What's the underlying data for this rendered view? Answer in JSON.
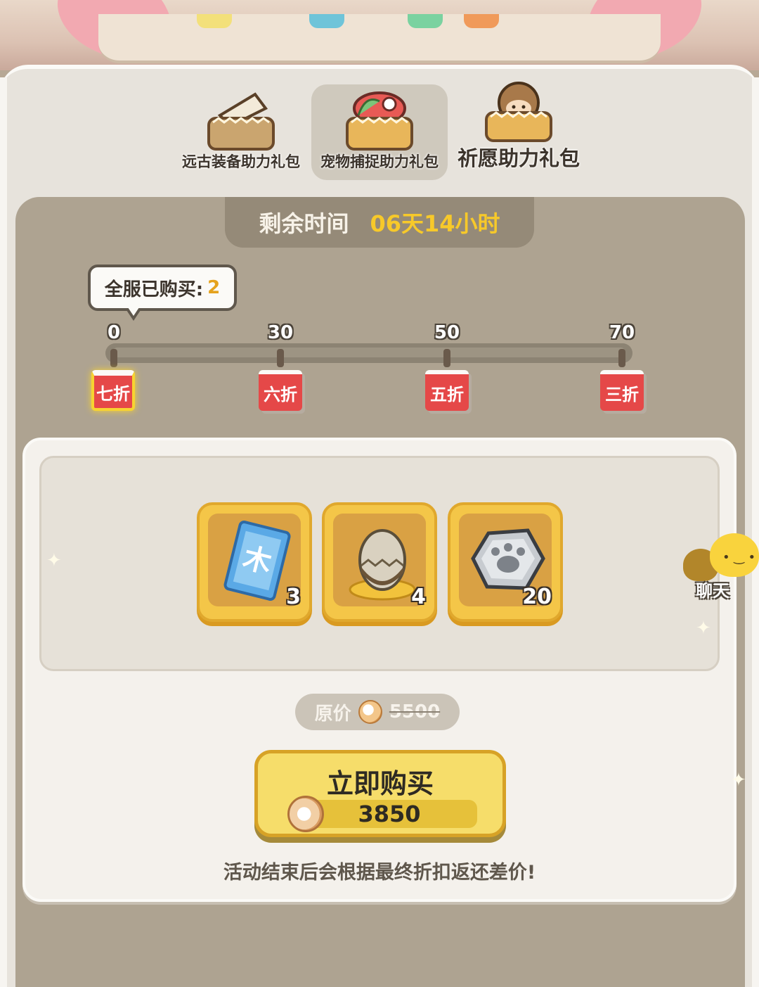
{
  "tabs": [
    {
      "label": "远古装备助力礼包",
      "active": false,
      "icon": "ancient-equipment-icon"
    },
    {
      "label": "宠物捕捉助力礼包",
      "active": true,
      "icon": "pet-capture-icon"
    },
    {
      "label": "祈愿助力礼包",
      "active": false,
      "icon": "wish-icon"
    }
  ],
  "timer": {
    "label": "剩余时间",
    "value": "06天14小时"
  },
  "purchased": {
    "label": "全服已购买:",
    "count": "2"
  },
  "milestones": [
    {
      "threshold": "0",
      "discount": "七折",
      "active": true
    },
    {
      "threshold": "30",
      "discount": "六折",
      "active": false
    },
    {
      "threshold": "50",
      "discount": "五折",
      "active": false
    },
    {
      "threshold": "70",
      "discount": "三折",
      "active": false
    }
  ],
  "rewards": [
    {
      "icon": "blue-ticket-icon",
      "qty": "3"
    },
    {
      "icon": "pet-egg-icon",
      "qty": "4"
    },
    {
      "icon": "paw-stone-icon",
      "qty": "20"
    }
  ],
  "original_price": {
    "label": "原价",
    "value": "5500"
  },
  "buy": {
    "label": "立即购买",
    "price": "3850"
  },
  "note": "活动结束后会根据最终折扣返还差价!",
  "chat": {
    "label": "聊天"
  },
  "colors": {
    "accent_gold": "#f7c92a",
    "discount_red": "#e54848",
    "panel_bg": "#e7e3dc"
  }
}
